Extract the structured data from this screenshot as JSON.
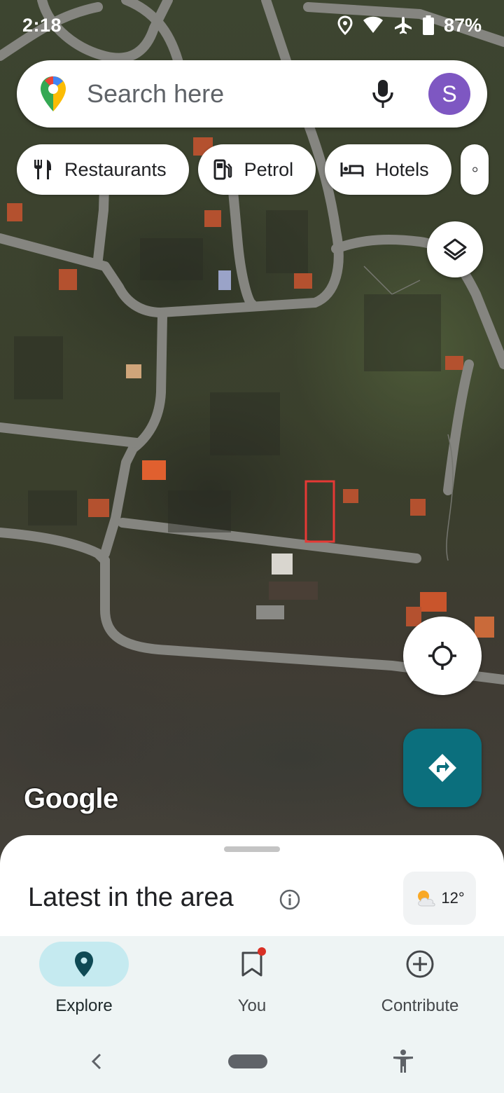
{
  "status_bar": {
    "time": "2:18",
    "battery": "87%",
    "icons": [
      "location-icon",
      "wifi-icon",
      "airplane-icon",
      "battery-icon"
    ]
  },
  "search": {
    "placeholder": "Search here",
    "avatar_initial": "S",
    "avatar_color": "#7e57c2"
  },
  "chips": [
    {
      "label": "Restaurants",
      "icon": "restaurant-icon"
    },
    {
      "label": "Petrol",
      "icon": "fuel-icon"
    },
    {
      "label": "Hotels",
      "icon": "bed-icon"
    }
  ],
  "map": {
    "attribution": "Google",
    "layer_button_icon": "layers-icon",
    "locate_icon": "crosshair-icon",
    "directions_icon": "directions-icon",
    "directions_color": "#0b6f7d"
  },
  "sheet": {
    "title": "Latest in the area",
    "weather": {
      "temp": "12°",
      "icon": "partly-cloudy-icon"
    }
  },
  "nav": [
    {
      "label": "Explore",
      "icon": "explore-pin-icon",
      "active": true
    },
    {
      "label": "You",
      "icon": "bookmark-icon",
      "active": false,
      "badge": true
    },
    {
      "label": "Contribute",
      "icon": "add-circle-icon",
      "active": false
    }
  ],
  "system_nav": {
    "icons": [
      "back-icon",
      "home-pill",
      "accessibility-icon"
    ]
  }
}
